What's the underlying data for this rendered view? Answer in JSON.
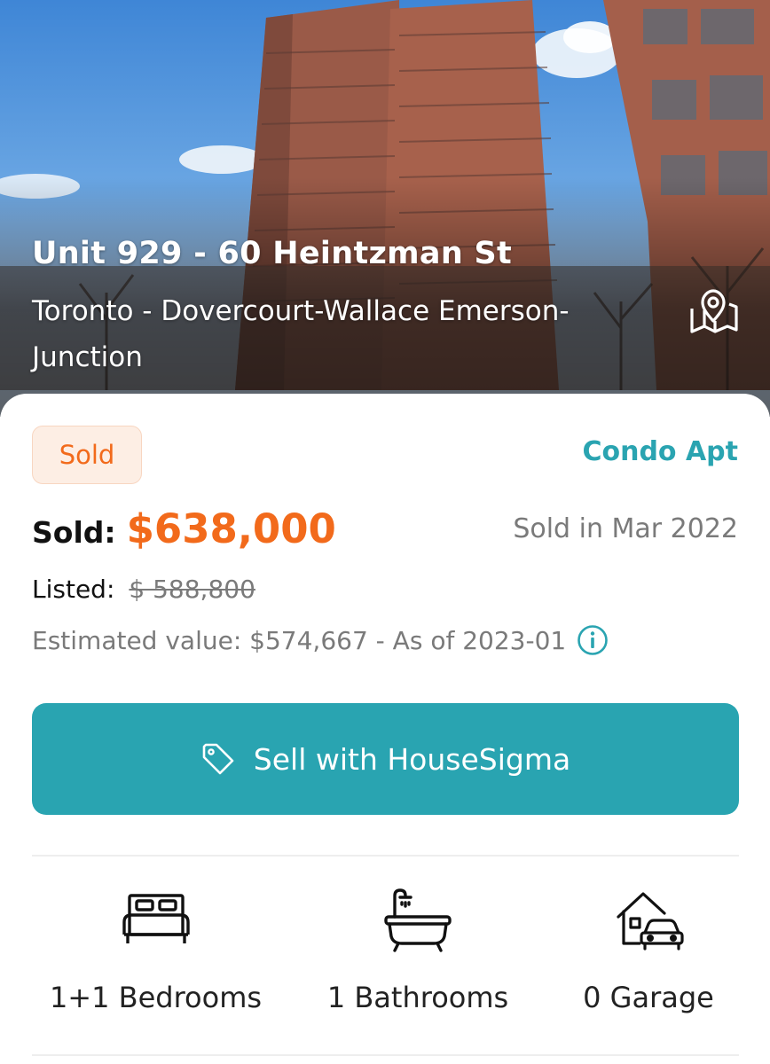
{
  "listing": {
    "title": "Unit 929 - 60 Heintzman St",
    "location": "Toronto - Dovercourt-Wallace Emerson-Junction",
    "status": "Sold",
    "property_type": "Condo Apt",
    "sold_label": "Sold:",
    "sold_price": "$638,000",
    "sold_date": "Sold in Mar 2022",
    "listed_label": "Listed:",
    "listed_price": "$ 588,800",
    "estimated_value": "Estimated value: $574,667 - As of 2023-01"
  },
  "actions": {
    "sell_label": "Sell with HouseSigma"
  },
  "features": [
    {
      "icon": "bed-icon",
      "label": "1+1 Bedrooms"
    },
    {
      "icon": "bathtub-icon",
      "label": "1 Bathrooms"
    },
    {
      "icon": "garage-icon",
      "label": "0 Garage"
    }
  ],
  "colors": {
    "accent": "#29a4b1",
    "price": "#f26a1b",
    "badge_bg": "#fdeee4",
    "muted_text": "#7a7a7a"
  }
}
